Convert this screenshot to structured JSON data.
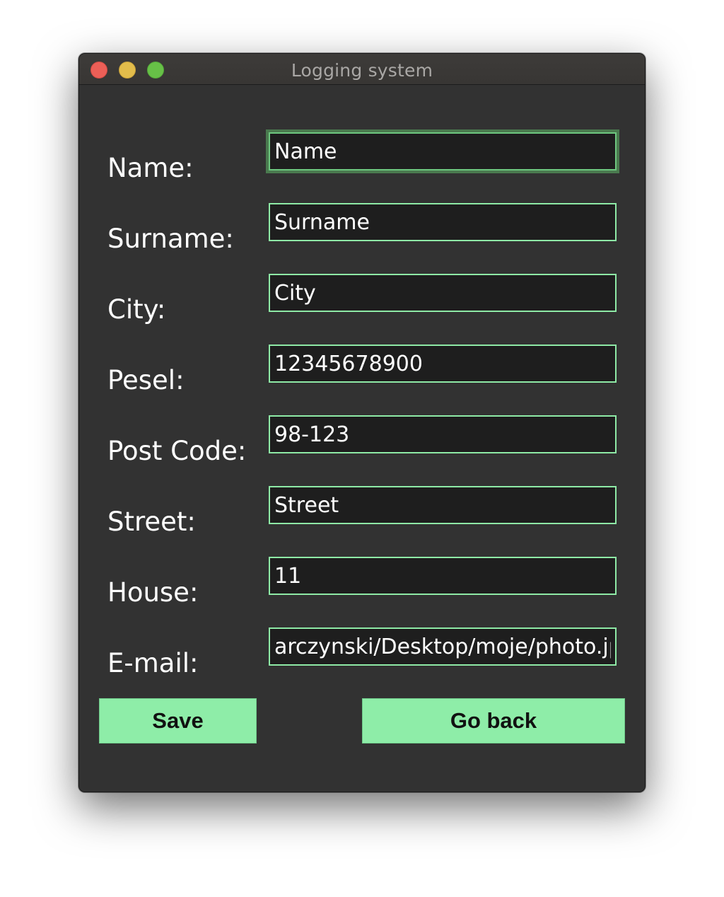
{
  "window": {
    "title": "Logging system"
  },
  "form": {
    "fields": [
      {
        "label": "Name:",
        "value": "Name"
      },
      {
        "label": "Surname:",
        "value": "Surname"
      },
      {
        "label": "City:",
        "value": "City"
      },
      {
        "label": "Pesel:",
        "value": "12345678900"
      },
      {
        "label": "Post Code:",
        "value": "98-123"
      },
      {
        "label": "Street:",
        "value": "Street"
      },
      {
        "label": "House:",
        "value": "11"
      },
      {
        "label": "E-mail:",
        "value": "arczynski/Desktop/moje/photo.jpg"
      }
    ]
  },
  "buttons": {
    "save_label": "Save",
    "back_label": "Go back"
  },
  "colors": {
    "window_bg": "#323232",
    "field_bg": "#1e1e1e",
    "field_border": "#8eeaa6",
    "button_bg": "#8eeda8",
    "close_light": "#ec5f57",
    "minimize_light": "#e2bc4b",
    "zoom_light": "#67c047"
  }
}
